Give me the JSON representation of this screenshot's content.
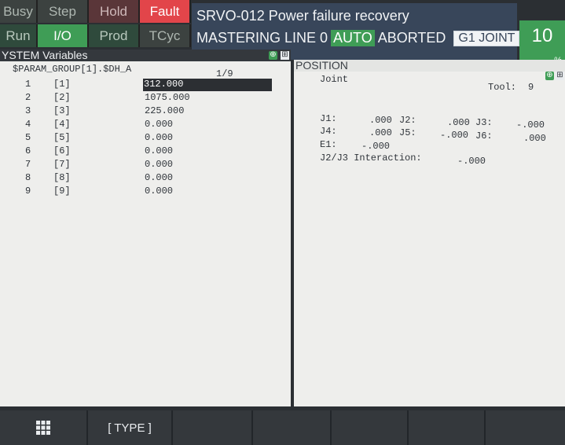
{
  "status": {
    "busy": "Busy",
    "step": "Step",
    "hold": "Hold",
    "fault": "Fault",
    "run": "Run",
    "io": "I/O",
    "prod": "Prod",
    "tcyc": "TCyc"
  },
  "message": {
    "alarm": "SRVO-012 Power failure recovery",
    "program": "MASTERING LINE 0",
    "mode": "AUTO",
    "state": "ABORTED",
    "group_coord": "G1 JOINT"
  },
  "override": {
    "value": "10",
    "unit": "%"
  },
  "left_panel": {
    "title": "YSTEM Variables",
    "path": "$PARAM_GROUP[1].$DH_A",
    "page": "1/9",
    "rows": [
      {
        "num": "1",
        "index": "[1]",
        "value": "312.000"
      },
      {
        "num": "2",
        "index": "[2]",
        "value": "1075.000"
      },
      {
        "num": "3",
        "index": "[3]",
        "value": "225.000"
      },
      {
        "num": "4",
        "index": "[4]",
        "value": "0.000"
      },
      {
        "num": "5",
        "index": "[5]",
        "value": "0.000"
      },
      {
        "num": "6",
        "index": "[6]",
        "value": "0.000"
      },
      {
        "num": "7",
        "index": "[7]",
        "value": "0.000"
      },
      {
        "num": "8",
        "index": "[8]",
        "value": "0.000"
      },
      {
        "num": "9",
        "index": "[9]",
        "value": "0.000"
      }
    ]
  },
  "right_panel": {
    "title": "POSITION",
    "mode": "Joint",
    "tool_label": "Tool:",
    "tool_value": "9",
    "j1_label": "J1:",
    "j1_value": ".000",
    "j2_label": "J2:",
    "j2_value": ".000",
    "j3_label": "J3:",
    "j3_value": "-.000",
    "j4_label": "J4:",
    "j4_value": ".000",
    "j5_label": "J5:",
    "j5_value": "-.000",
    "j6_label": "J6:",
    "j6_value": ".000",
    "e1_label": "E1:",
    "e1_value": "-.000",
    "interaction_label": "J2/J3 Interaction:",
    "interaction_value": "-.000"
  },
  "function_keys": {
    "menu_icon": "grid-icon",
    "f1": "[ TYPE ]"
  },
  "colors": {
    "auto_green": "#3f9d56",
    "fault_red": "#e2454a",
    "message_bg": "#38465a"
  }
}
